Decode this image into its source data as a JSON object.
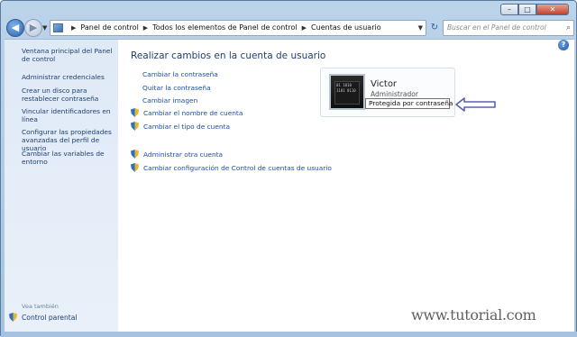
{
  "window_controls": {
    "minimize": "–",
    "maximize": "□",
    "close": "✕"
  },
  "address_bar": {
    "crumbs": [
      "Panel de control",
      "Todos los elementos de Panel de control",
      "Cuentas de usuario"
    ]
  },
  "search": {
    "placeholder": "Buscar en el Panel de control"
  },
  "help_icon": "?",
  "sidebar": {
    "items": [
      "Ventana principal del Panel de control",
      "Administrar credenciales",
      "Crear un disco para restablecer contraseña",
      "Vincular identificadores en línea",
      "Configurar las propiedades avanzadas del perfil de usuario",
      "Cambiar las variables de entorno"
    ],
    "see_also": "Vea también",
    "parental_control": "Control parental"
  },
  "main": {
    "heading": "Realizar cambios en la cuenta de usuario",
    "tasks": [
      {
        "label": "Cambiar la contraseña",
        "shield": false
      },
      {
        "label": "Quitar la contraseña",
        "shield": false
      },
      {
        "label": "Cambiar imagen",
        "shield": false
      },
      {
        "label": "Cambiar el nombre de cuenta",
        "shield": true
      },
      {
        "label": "Cambiar el tipo de cuenta",
        "shield": true
      },
      {
        "label": "Administrar otra cuenta",
        "shield": true
      },
      {
        "label": "Cambiar configuración de Control de cuentas de usuario",
        "shield": true
      }
    ]
  },
  "user": {
    "name": "Victor",
    "type": "Administrador",
    "status": "Protegida por contraseña",
    "avatar_text": "01 1010 1101 0110"
  },
  "watermark": "www.tutorial.com",
  "colors": {
    "link": "#1b4fa2",
    "sidebar_link": "#1e3e6e",
    "callout": "#5b5fb6"
  }
}
